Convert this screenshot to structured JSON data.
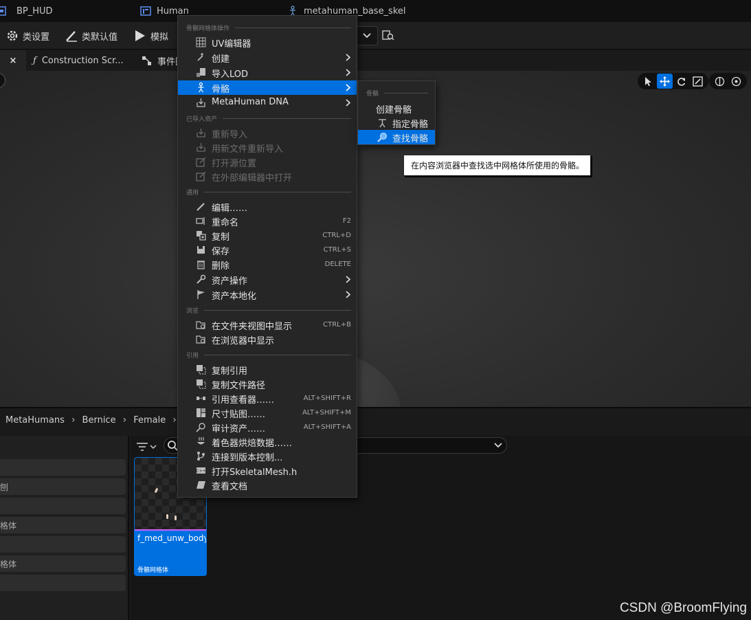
{
  "asset_tabs": [
    {
      "label": "BP_HUD"
    },
    {
      "label": "Human"
    },
    {
      "label": "metahuman_base_skel"
    }
  ],
  "toolbar": {
    "class_settings": "类设置",
    "class_defaults": "类默认值",
    "simulate": "模拟"
  },
  "editor_tabs": {
    "close": "×",
    "construction_script": "Construction Scr...",
    "event_graph": "事件图表"
  },
  "context_menu": {
    "sections": {
      "mesh_actions": "骨骼网格体操作",
      "imported_asset": "已导入资产",
      "common": "通用",
      "explore": "浏览",
      "references": "引用"
    },
    "items": {
      "uv_editor": "UV编辑器",
      "create": "创建",
      "import_lod": "导入LOD",
      "skeleton": "骨骼",
      "metahuman_dna": "MetaHuman DNA",
      "reimport": "重新导入",
      "reimport_new_file": "用新文件重新导入",
      "open_source_location": "打开源位置",
      "open_in_external_editor": "在外部编辑器中打开",
      "edit": "编辑……",
      "rename": "重命名",
      "rename_shortcut": "F2",
      "duplicate": "复制",
      "duplicate_shortcut": "CTRL+D",
      "save": "保存",
      "save_shortcut": "CTRL+S",
      "delete": "删除",
      "delete_shortcut": "DELETE",
      "asset_actions": "资产操作",
      "asset_localization": "资产本地化",
      "show_in_folder": "在文件夹视图中显示",
      "show_in_folder_shortcut": "CTRL+B",
      "show_in_explorer": "在浏览器中显示",
      "copy_reference": "复制引用",
      "copy_file_path": "复制文件路径",
      "reference_viewer": "引用查看器……",
      "reference_viewer_shortcut": "ALT+SHIFT+R",
      "size_map": "尺寸贴图……",
      "size_map_shortcut": "ALT+SHIFT+M",
      "audit_assets": "审计资产……",
      "audit_assets_shortcut": "ALT+SHIFT+A",
      "shader_cook_data": "着色器烘焙数据……",
      "connect_source_control": "连接到版本控制...",
      "open_header": "打开SkeletalMesh.h",
      "view_documentation": "查看文档"
    }
  },
  "skeleton_submenu": {
    "section": "骨骼",
    "create_skeleton": "创建骨骼",
    "assign_skeleton": "指定骨骼",
    "find_skeleton": "查找骨骼"
  },
  "tooltip": "在内容浏览器中查找选中网格体所使用的骨骼。",
  "content_browser": {
    "breadcrumbs": [
      "MetaHumans",
      "Bernice",
      "Female"
    ],
    "sidebar_filters": [
      "",
      "刨",
      "",
      "格体",
      "",
      "格体",
      ""
    ],
    "asset": {
      "name": "f_med_unw_body",
      "type": "骨骼网格体"
    }
  },
  "watermark": "CSDN @BroomFlying",
  "colors": {
    "highlight": "#0070e0",
    "menu_bg": "#262626",
    "asset_type_bar": "#d35cff"
  }
}
